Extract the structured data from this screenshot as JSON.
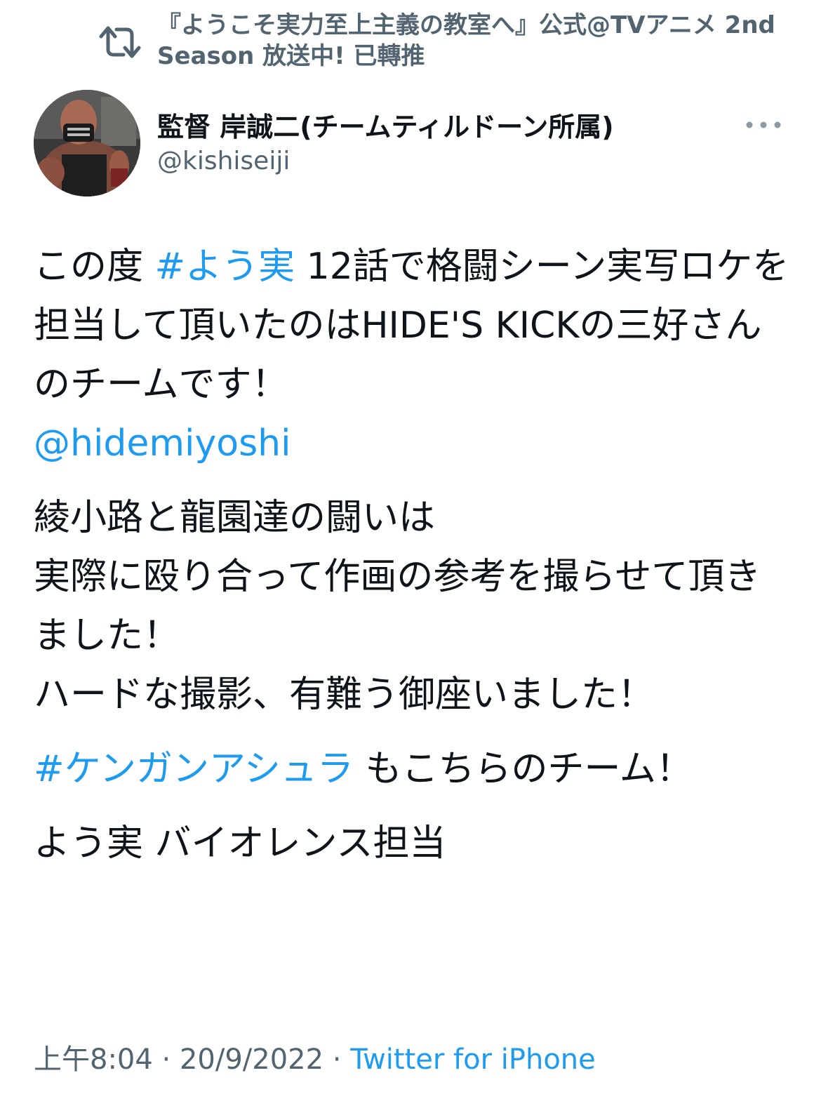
{
  "retweet": {
    "icon": "retweet-icon",
    "text": "『ようこそ実力至上主義の教室へ』公式@TVアニメ 2nd Season 放送中! 已轉推"
  },
  "author": {
    "display_name": "監督 岸誠二(チームティルドーン所属)",
    "handle": "@kishiseiji",
    "avatar_icon": "avatar"
  },
  "more_icon": "more-dots-icon",
  "tweet": {
    "p1": {
      "t1": "この度 ",
      "hashtag": "#よう実",
      "t2": " 12話で格闘シーン実写ロケを担当して頂いたのはHIDE'S KICKの三好さんのチームです！",
      "mention": "@hidemiyoshi"
    },
    "p2": {
      "line1": "綾小路と龍園達の闘いは",
      "line2": "実際に殴り合って作画の参考を撮らせて頂きました！",
      "line3": "ハードな撮影、有難う御座いました！"
    },
    "p3": {
      "hashtag": "#ケンガンアシュラ",
      "t1": " もこちらのチーム！"
    },
    "p4": {
      "t1": "よう実 バイオレンス担当"
    }
  },
  "meta": {
    "time": "上午8:04",
    "sep1": " · ",
    "date": "20/9/2022",
    "sep2": " · ",
    "source": "Twitter for iPhone"
  },
  "colors": {
    "link": "#1d9bf0",
    "secondary": "#536471",
    "text": "#0f1419"
  }
}
